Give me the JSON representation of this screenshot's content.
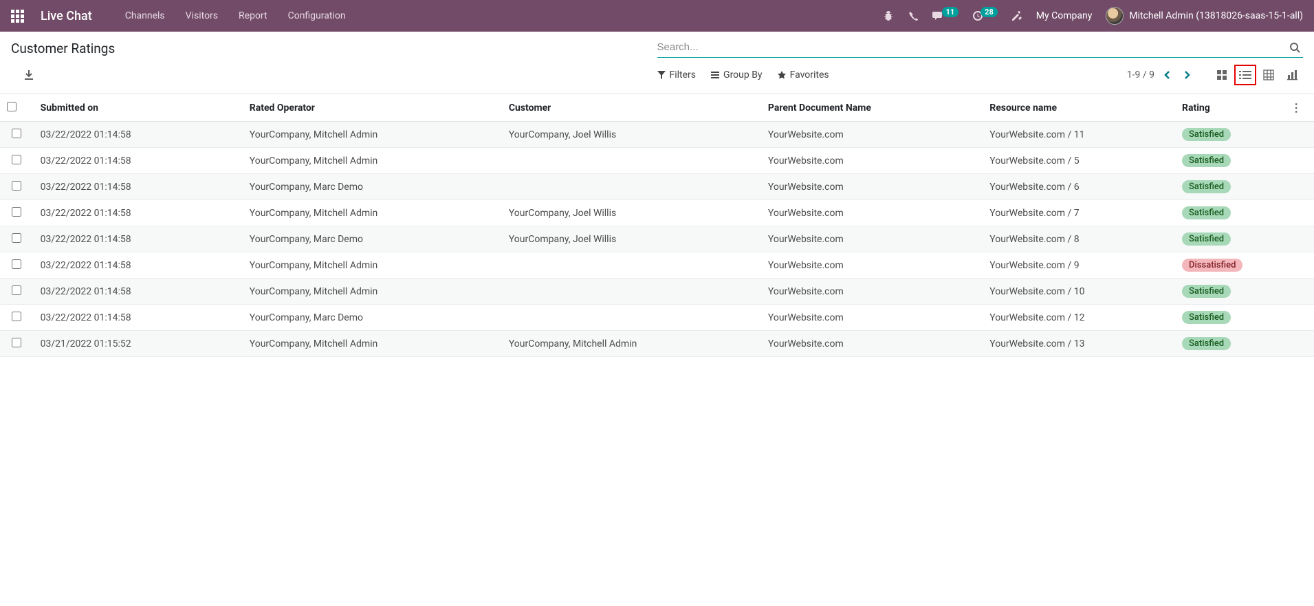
{
  "header": {
    "brand": "Live Chat",
    "menu": [
      "Channels",
      "Visitors",
      "Report",
      "Configuration"
    ],
    "messages_badge": "11",
    "activities_badge": "28",
    "company": "My Company",
    "user": "Mitchell Admin (13818026-saas-15-1-all)"
  },
  "control": {
    "title": "Customer Ratings",
    "search_placeholder": "Search...",
    "filters_label": "Filters",
    "groupby_label": "Group By",
    "favorites_label": "Favorites",
    "pager": "1-9 / 9"
  },
  "columns": {
    "submitted": "Submitted on",
    "operator": "Rated Operator",
    "customer": "Customer",
    "parent": "Parent Document Name",
    "resource": "Resource name",
    "rating": "Rating"
  },
  "rows": [
    {
      "submitted": "03/22/2022 01:14:58",
      "operator": "YourCompany, Mitchell Admin",
      "customer": "YourCompany, Joel Willis",
      "parent": "YourWebsite.com",
      "resource": "YourWebsite.com / 11",
      "rating": "Satisfied",
      "rating_class": "badge-satisfied"
    },
    {
      "submitted": "03/22/2022 01:14:58",
      "operator": "YourCompany, Mitchell Admin",
      "customer": "",
      "parent": "YourWebsite.com",
      "resource": "YourWebsite.com / 5",
      "rating": "Satisfied",
      "rating_class": "badge-satisfied"
    },
    {
      "submitted": "03/22/2022 01:14:58",
      "operator": "YourCompany, Marc Demo",
      "customer": "",
      "parent": "YourWebsite.com",
      "resource": "YourWebsite.com / 6",
      "rating": "Satisfied",
      "rating_class": "badge-satisfied"
    },
    {
      "submitted": "03/22/2022 01:14:58",
      "operator": "YourCompany, Mitchell Admin",
      "customer": "YourCompany, Joel Willis",
      "parent": "YourWebsite.com",
      "resource": "YourWebsite.com / 7",
      "rating": "Satisfied",
      "rating_class": "badge-satisfied"
    },
    {
      "submitted": "03/22/2022 01:14:58",
      "operator": "YourCompany, Marc Demo",
      "customer": "YourCompany, Joel Willis",
      "parent": "YourWebsite.com",
      "resource": "YourWebsite.com / 8",
      "rating": "Satisfied",
      "rating_class": "badge-satisfied"
    },
    {
      "submitted": "03/22/2022 01:14:58",
      "operator": "YourCompany, Mitchell Admin",
      "customer": "",
      "parent": "YourWebsite.com",
      "resource": "YourWebsite.com / 9",
      "rating": "Dissatisfied",
      "rating_class": "badge-dissatisfied"
    },
    {
      "submitted": "03/22/2022 01:14:58",
      "operator": "YourCompany, Mitchell Admin",
      "customer": "",
      "parent": "YourWebsite.com",
      "resource": "YourWebsite.com / 10",
      "rating": "Satisfied",
      "rating_class": "badge-satisfied"
    },
    {
      "submitted": "03/22/2022 01:14:58",
      "operator": "YourCompany, Marc Demo",
      "customer": "",
      "parent": "YourWebsite.com",
      "resource": "YourWebsite.com / 12",
      "rating": "Satisfied",
      "rating_class": "badge-satisfied"
    },
    {
      "submitted": "03/21/2022 01:15:52",
      "operator": "YourCompany, Mitchell Admin",
      "customer": "YourCompany, Mitchell Admin",
      "parent": "YourWebsite.com",
      "resource": "YourWebsite.com / 13",
      "rating": "Satisfied",
      "rating_class": "badge-satisfied"
    }
  ]
}
